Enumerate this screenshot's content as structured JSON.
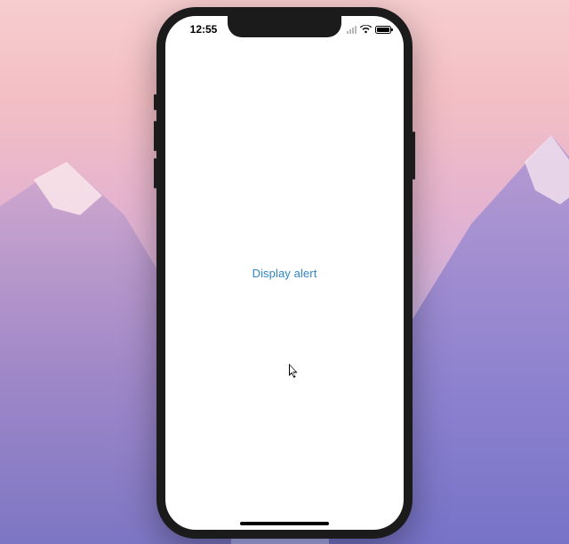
{
  "statusbar": {
    "time": "12:55"
  },
  "app": {
    "display_alert_label": "Display alert"
  }
}
